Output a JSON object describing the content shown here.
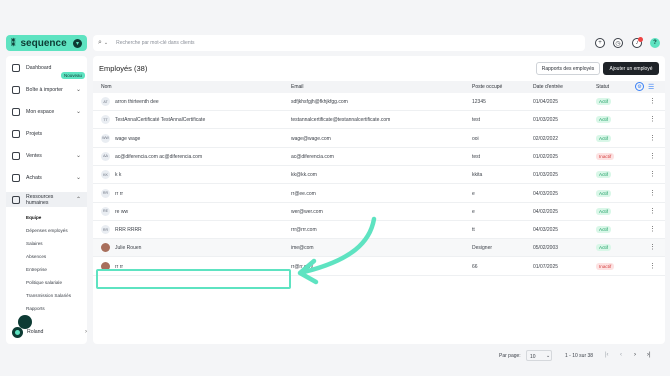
{
  "brand": {
    "name": "sequence"
  },
  "search": {
    "placeholder": "Recherche par mot-clé dans clients"
  },
  "sidebar": {
    "badge_new": "Nouveau",
    "items": [
      {
        "label": "Dashboard"
      },
      {
        "label": "Boîte à importer"
      },
      {
        "label": "Mon espace"
      },
      {
        "label": "Projets"
      },
      {
        "label": "Ventes"
      },
      {
        "label": "Achats"
      },
      {
        "label": "Ressources humaines"
      }
    ],
    "sub_items": [
      {
        "label": "Equipe"
      },
      {
        "label": "Dépenses employés"
      },
      {
        "label": "Salaires"
      },
      {
        "label": "Absences"
      },
      {
        "label": "Entreprise"
      },
      {
        "label": "Politique salariale"
      },
      {
        "label": "Transmission Salariés"
      },
      {
        "label": "Rapports"
      }
    ],
    "user": {
      "name": "Roland"
    }
  },
  "main": {
    "title": "Employés (38)",
    "reports_button": "Rapports des employés",
    "add_button": "Ajouter un employé",
    "columns": [
      "Nom",
      "Email",
      "Poste occupé",
      "Date d'entrée",
      "Statut"
    ],
    "rows": [
      {
        "initials": "AT",
        "name": "arron thirteenth dee",
        "email": "sdfjkhsfgjh@fkhjkfgg.com",
        "poste": "12345",
        "date": "01/04/2025",
        "status": "Actif"
      },
      {
        "initials": "TT",
        "name": "TestAnnalCertificaté TestAnnalCertificate",
        "email": "testannalcertificate@testannalcertificate.com",
        "poste": "test",
        "date": "01/03/2025",
        "status": "Actif"
      },
      {
        "initials": "WW",
        "name": "wage wage",
        "email": "wage@wage.com",
        "poste": "ooi",
        "date": "02/02/2022",
        "status": "Actif"
      },
      {
        "initials": "AA",
        "name": "ac@diferencia.com ac@diferencia.com",
        "email": "ac@diferencia.com",
        "poste": "test",
        "date": "01/02/2025",
        "status": "Inactif"
      },
      {
        "initials": "KK",
        "name": "k k",
        "email": "kk@kk.com",
        "poste": "kkita",
        "date": "01/03/2025",
        "status": "Actif"
      },
      {
        "initials": "RR",
        "name": "rr rr",
        "email": "rr@ee.com",
        "poste": "e",
        "date": "04/03/2025",
        "status": "Actif"
      },
      {
        "initials": "RE",
        "name": "re ww",
        "email": "wer@wer.com",
        "poste": "e",
        "date": "04/02/2025",
        "status": "Actif"
      },
      {
        "initials": "RR",
        "name": "RRR RRRR",
        "email": "rrr@rrr.com",
        "poste": "tt",
        "date": "04/03/2025",
        "status": "Actif"
      },
      {
        "initials": "",
        "name": "Julie Rouen",
        "email": "ime@com",
        "poste": "Designer",
        "date": "05/02/2003",
        "status": "Actif"
      },
      {
        "initials": "",
        "name": "rr rr",
        "email": "rr@rr.com",
        "poste": "66",
        "date": "01/07/2025",
        "status": "Inactif"
      }
    ]
  },
  "pagination": {
    "per_page_label": "Par page:",
    "per_page_value": "10",
    "range": "1 - 10 sur 38"
  },
  "colors": {
    "accent": "#5ee3c1",
    "active": "#149a5e",
    "inactive": "#d43d3d"
  }
}
